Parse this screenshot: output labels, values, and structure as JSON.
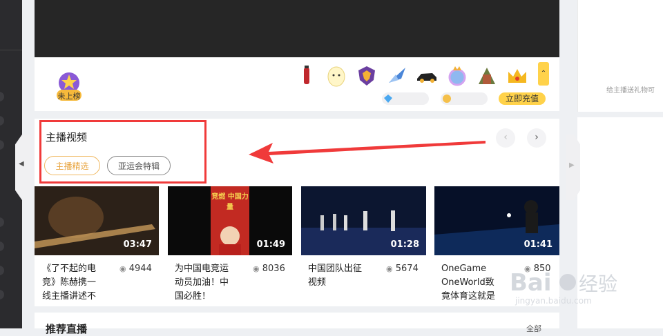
{
  "gift_bar": {
    "rank_label": "未上榜",
    "recharge_label": "立即充值",
    "gifts": [
      "cola-gift-icon",
      "egg-gift-icon",
      "crest-gift-icon",
      "jet-gift-icon",
      "car-gift-icon",
      "crown-orb-gift-icon",
      "castle-gift-icon",
      "crown-gift-icon"
    ]
  },
  "chat": {
    "hint": "给主播送礼物可"
  },
  "video_section": {
    "title": "主播视频",
    "tabs": [
      "主播精选",
      "亚运会特辑"
    ],
    "videos": [
      {
        "title": "《了不起的电竞》陈赫携一线主播讲述不",
        "title_lines": [
          "《了不起的电",
          "竞》陈赫携一",
          "线主播讲述不"
        ],
        "views": "4944",
        "duration": "03:47"
      },
      {
        "title": "为中国电竞运动员加油！中国必胜！",
        "title_lines": [
          "为中国电竞运",
          "动员加油！中",
          "国必胜！"
        ],
        "views": "8036",
        "duration": "01:49"
      },
      {
        "title": "中国团队出征视频",
        "title_lines": [
          "中国团队出征",
          "视频"
        ],
        "views": "5674",
        "duration": "01:28"
      },
      {
        "title": "OneGame OneWorld致竟体育这就是",
        "title_lines": [
          "OneGame",
          "OneWorld致",
          "竟体育这就是"
        ],
        "views": "850",
        "duration": "01:41"
      }
    ],
    "thumb2_text": "竞燃 中国力量"
  },
  "recommend": {
    "title": "推荐直播",
    "more": "全部"
  },
  "watermark": {
    "brand": "Baidu经验",
    "url": "jingyan.baidu.com"
  }
}
